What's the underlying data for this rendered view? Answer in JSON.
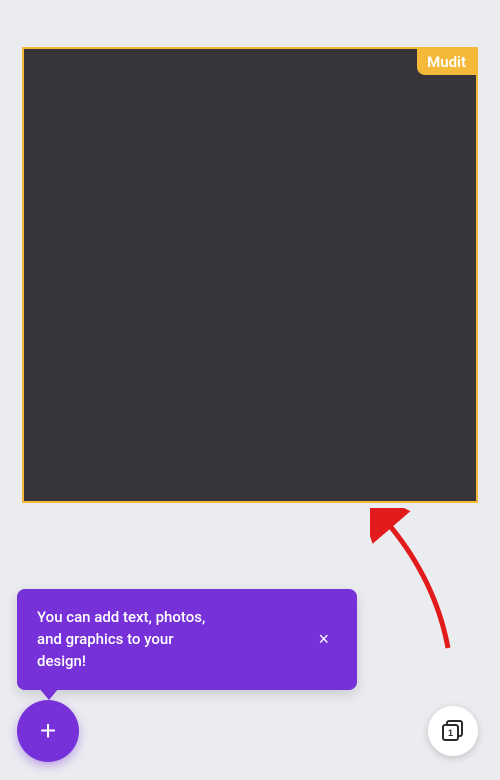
{
  "canvas": {
    "user_badge": "Mudit"
  },
  "tooltip": {
    "text": "You can add text, photos, and graphics to your design!",
    "close_label": "×"
  },
  "fab": {
    "add_label": "+"
  },
  "pages": {
    "count": "1"
  }
}
